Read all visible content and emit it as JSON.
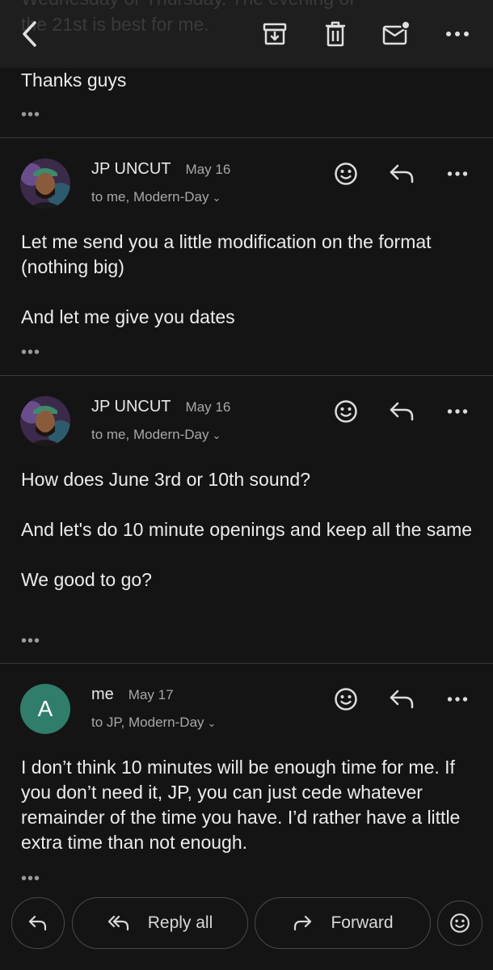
{
  "colors": {
    "background": "#141414",
    "topbar": "#1e1e1e",
    "avatar_a": "#2f7d6a",
    "text": "#ececec",
    "muted": "#a8a8a8"
  },
  "topbar": {
    "ghost_text_line1": "Wednesday or Thursday.  The evening of",
    "ghost_text_line2": "the 21st is best for me.",
    "icons": [
      "back-icon",
      "archive-icon",
      "trash-icon",
      "mark-unread-icon",
      "more-icon"
    ]
  },
  "prev_message": {
    "tail": "Thanks guys",
    "more": "•••"
  },
  "messages": [
    {
      "sender": "JP UNCUT",
      "date": "May 16",
      "recipients": "to me, Modern-Day",
      "chevron": "⌄",
      "avatar_type": "photo",
      "paragraphs": [
        "Let me send you a little modification on the format (nothing big)",
        "And let me give you dates"
      ],
      "more": "•••"
    },
    {
      "sender": "JP UNCUT",
      "date": "May 16",
      "recipients": "to me, Modern-Day",
      "chevron": "⌄",
      "avatar_type": "photo",
      "paragraphs": [
        "How does June 3rd or 10th sound?",
        "And let's do 10 minute openings and keep all the same",
        "We good to go?"
      ],
      "more": "•••"
    },
    {
      "sender": "me",
      "date": "May 17",
      "recipients": "to JP, Modern-Day",
      "chevron": "⌄",
      "avatar_type": "letter",
      "avatar_letter": "A",
      "paragraphs": [
        "I don’t think 10 minutes will be enough time for me.  If you don’t need it, JP, you can just cede whatever remainder of the time you have.  I’d rather have a little extra time than not enough."
      ],
      "more": "•••"
    }
  ],
  "bottom": {
    "reply_all": "Reply all",
    "forward": "Forward"
  }
}
